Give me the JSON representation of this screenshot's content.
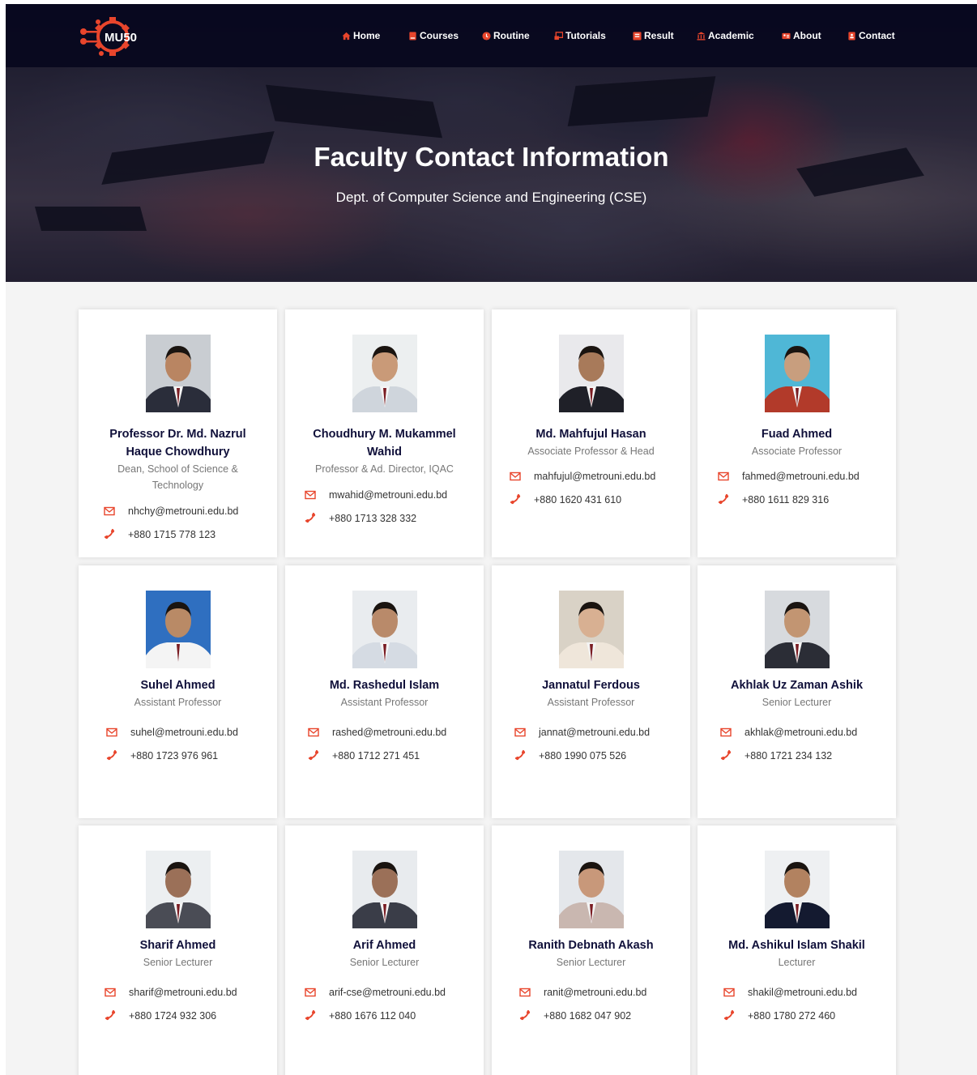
{
  "brand": {
    "logo_text": "MU50",
    "accent": "#e8452c",
    "navy": "#10103a"
  },
  "nav": [
    {
      "label": "Home",
      "icon": "home-icon"
    },
    {
      "label": "Courses",
      "icon": "book-icon"
    },
    {
      "label": "Routine",
      "icon": "clock-icon"
    },
    {
      "label": "Tutorials",
      "icon": "video-icon"
    },
    {
      "label": "Result",
      "icon": "result-icon"
    },
    {
      "label": "Academic",
      "icon": "institution-icon"
    },
    {
      "label": "About",
      "icon": "id-card-icon"
    },
    {
      "label": "Contact",
      "icon": "contact-book-icon"
    }
  ],
  "hero": {
    "title": "Faculty Contact Information",
    "subtitle": "Dept. of Computer Science and Engineering (CSE)"
  },
  "faculty": [
    {
      "name": "Professor Dr. Md. Nazrul Haque Chowdhury",
      "role": "Dean, School of Science & Technology",
      "email": "nhchy@metrouni.edu.bd",
      "phone": "+880 1715 778 123"
    },
    {
      "name": "Choudhury M. Mukammel Wahid",
      "role": "Professor & Ad. Director, IQAC",
      "email": "mwahid@metrouni.edu.bd",
      "phone": "+880 1713 328 332"
    },
    {
      "name": "Md. Mahfujul Hasan",
      "role": "Associate Professor & Head",
      "email": "mahfujul@metrouni.edu.bd",
      "phone": "+880 1620 431 610"
    },
    {
      "name": "Fuad Ahmed",
      "role": "Associate Professor",
      "email": "fahmed@metrouni.edu.bd",
      "phone": "+880 1611 829 316"
    },
    {
      "name": "Suhel Ahmed",
      "role": "Assistant Professor",
      "email": "suhel@metrouni.edu.bd",
      "phone": "+880 1723 976 961"
    },
    {
      "name": "Md. Rashedul Islam",
      "role": "Assistant Professor",
      "email": "rashed@metrouni.edu.bd",
      "phone": "+880 1712 271 451"
    },
    {
      "name": "Jannatul Ferdous",
      "role": "Assistant Professor",
      "email": "jannat@metrouni.edu.bd",
      "phone": "+880 1990 075 526"
    },
    {
      "name": "Akhlak Uz Zaman Ashik",
      "role": "Senior Lecturer",
      "email": "akhlak@metrouni.edu.bd",
      "phone": "+880 1721 234 132"
    },
    {
      "name": "Sharif Ahmed",
      "role": "Senior Lecturer",
      "email": "sharif@metrouni.edu.bd",
      "phone": "+880 1724 932 306"
    },
    {
      "name": "Arif Ahmed",
      "role": "Senior Lecturer",
      "email": "arif-cse@metrouni.edu.bd",
      "phone": "+880 1676 112 040"
    },
    {
      "name": "Ranith Debnath Akash",
      "role": "Senior Lecturer",
      "email": "ranit@metrouni.edu.bd",
      "phone": "+880 1682 047 902"
    },
    {
      "name": "Md. Ashikul Islam Shakil",
      "role": "Lecturer",
      "email": "shakil@metrouni.edu.bd",
      "phone": "+880 1780 272 460"
    }
  ]
}
